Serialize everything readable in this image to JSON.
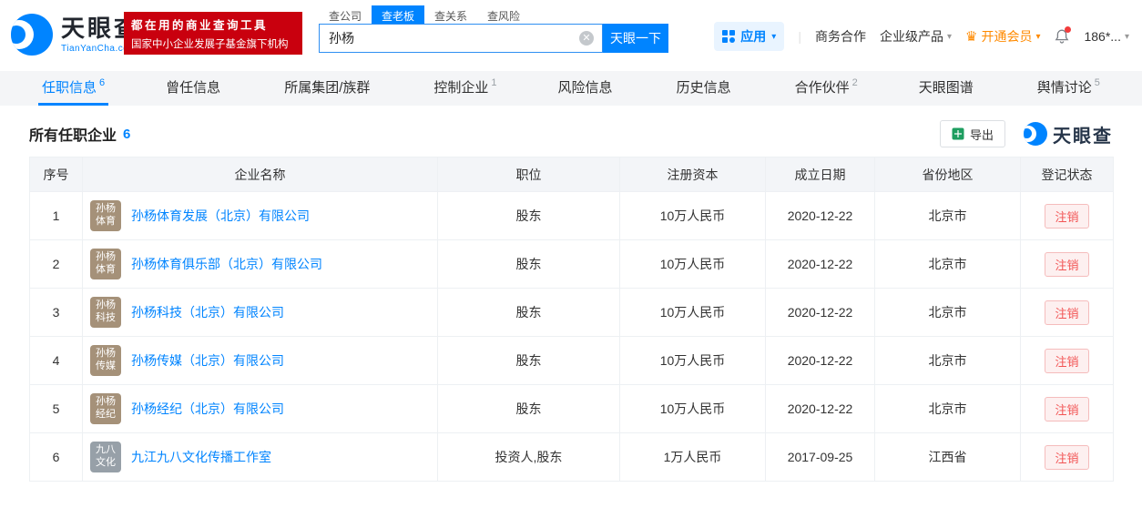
{
  "header": {
    "logo": {
      "title": "天眼查",
      "subtitle": "TianYanCha.com"
    },
    "promo": {
      "line1": "都在用的商业查询工具",
      "line2": "国家中小企业发展子基金旗下机构"
    },
    "search": {
      "tabs": [
        {
          "label": "查公司",
          "active": false
        },
        {
          "label": "查老板",
          "active": true
        },
        {
          "label": "查关系",
          "active": false
        },
        {
          "label": "查风险",
          "active": false
        }
      ],
      "value": "孙杨",
      "button": "天眼一下"
    },
    "menu": {
      "apps": "应用",
      "business": "商务合作",
      "enterprise": "企业级产品",
      "vip": "开通会员",
      "phone": "186*..."
    }
  },
  "tabs": [
    {
      "label": "任职信息",
      "count": "6",
      "active": true
    },
    {
      "label": "曾任信息",
      "count": "",
      "active": false
    },
    {
      "label": "所属集团/族群",
      "count": "",
      "active": false
    },
    {
      "label": "控制企业",
      "count": "1",
      "active": false
    },
    {
      "label": "风险信息",
      "count": "",
      "active": false
    },
    {
      "label": "历史信息",
      "count": "",
      "active": false
    },
    {
      "label": "合作伙伴",
      "count": "2",
      "active": false
    },
    {
      "label": "天眼图谱",
      "count": "",
      "active": false
    },
    {
      "label": "舆情讨论",
      "count": "5",
      "active": false
    }
  ],
  "section": {
    "title": "所有任职企业",
    "count": "6",
    "export_label": "导出",
    "watermark": "天眼查"
  },
  "table": {
    "headers": [
      "序号",
      "企业名称",
      "职位",
      "注册资本",
      "成立日期",
      "省份地区",
      "登记状态"
    ],
    "rows": [
      {
        "no": "1",
        "avatar": {
          "line1": "孙杨",
          "line2": "体育",
          "color": "#a59179"
        },
        "company": "孙杨体育发展（北京）有限公司",
        "position": "股东",
        "capital": "10万人民币",
        "date": "2020-12-22",
        "region": "北京市",
        "status": "注销"
      },
      {
        "no": "2",
        "avatar": {
          "line1": "孙杨",
          "line2": "体育",
          "color": "#a59179"
        },
        "company": "孙杨体育俱乐部（北京）有限公司",
        "position": "股东",
        "capital": "10万人民币",
        "date": "2020-12-22",
        "region": "北京市",
        "status": "注销"
      },
      {
        "no": "3",
        "avatar": {
          "line1": "孙杨",
          "line2": "科技",
          "color": "#a59179"
        },
        "company": "孙杨科技（北京）有限公司",
        "position": "股东",
        "capital": "10万人民币",
        "date": "2020-12-22",
        "region": "北京市",
        "status": "注销"
      },
      {
        "no": "4",
        "avatar": {
          "line1": "孙杨",
          "line2": "传媒",
          "color": "#a59179"
        },
        "company": "孙杨传媒（北京）有限公司",
        "position": "股东",
        "capital": "10万人民币",
        "date": "2020-12-22",
        "region": "北京市",
        "status": "注销"
      },
      {
        "no": "5",
        "avatar": {
          "line1": "孙杨",
          "line2": "经纪",
          "color": "#a59179"
        },
        "company": "孙杨经纪（北京）有限公司",
        "position": "股东",
        "capital": "10万人民币",
        "date": "2020-12-22",
        "region": "北京市",
        "status": "注销"
      },
      {
        "no": "6",
        "avatar": {
          "line1": "九八",
          "line2": "文化",
          "color": "#97a0a8"
        },
        "company": "九江九八文化传播工作室",
        "position": "投资人,股东",
        "capital": "1万人民币",
        "date": "2017-09-25",
        "region": "江西省",
        "status": "注销"
      }
    ]
  }
}
